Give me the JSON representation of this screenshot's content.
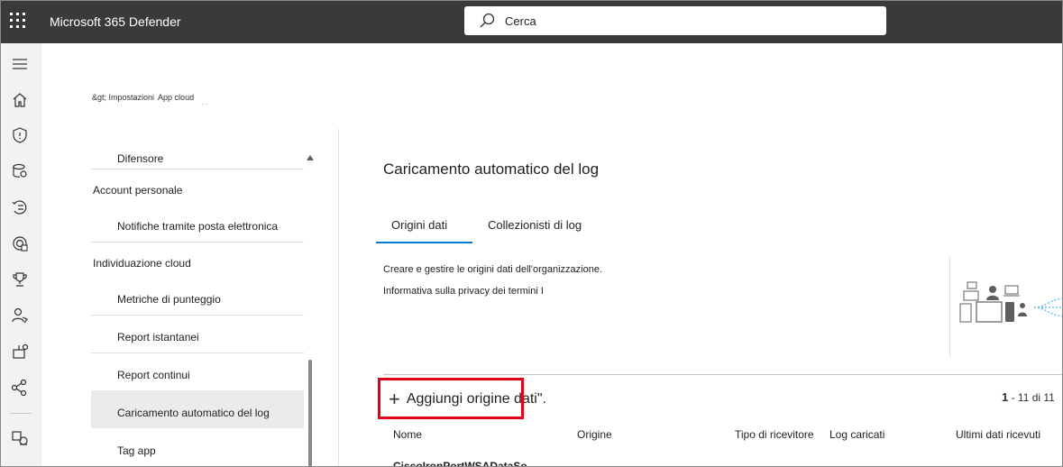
{
  "topbar": {
    "app_title": "Microsoft 365 Defender",
    "search_placeholder": "Cerca"
  },
  "rail": {
    "icons": [
      "menu-icon",
      "home-icon",
      "shield-icon",
      "assets-icon",
      "incidents-icon",
      "threat-icon",
      "trophy-icon",
      "partner-icon",
      "settings-gear-icon",
      "graph-icon",
      "apps-icon"
    ]
  },
  "breadcrumb": {
    "items": [
      "&gt; Impostazioni",
      "App cloud"
    ],
    "ellipsis": ". ."
  },
  "settings_nav": {
    "items": [
      {
        "label": "Difensore",
        "level": "sub"
      },
      {
        "label": "Account personale",
        "level": "header"
      },
      {
        "label": "Notifiche tramite posta elettronica",
        "level": "sub"
      },
      {
        "label": "Individuazione cloud",
        "level": "header"
      },
      {
        "label": "Metriche di punteggio",
        "level": "sub"
      },
      {
        "label": "Report istantanei",
        "level": "sub"
      },
      {
        "label": "Report continui",
        "level": "sub"
      },
      {
        "label": "Caricamento automatico del log",
        "level": "sub",
        "selected": true
      },
      {
        "label": "Tag app",
        "level": "sub"
      }
    ]
  },
  "main": {
    "title": "Caricamento automatico del log",
    "tabs": [
      {
        "label": "Origini dati",
        "active": true
      },
      {
        "label": "Collezionisti di log",
        "active": false
      }
    ],
    "description": "Creare e gestire le origini dati dell'organizzazione.",
    "privacy_text": "Informativa sulla privacy dei termini I",
    "add_button": "Aggiungi origine dati\".",
    "pager": {
      "current": "1",
      "rest": "- 11 di 11"
    },
    "columns": [
      "Nome",
      "Origine",
      "Tipo di ricevitore",
      "Log caricati",
      "Ultimi dati ricevuti"
    ],
    "rows": [
      {
        "name": "CiscoIronPortWSADataSo"
      }
    ]
  },
  "colors": {
    "accent": "#0078d4",
    "highlight": "#e3001b",
    "topbar": "#3b3a39"
  }
}
